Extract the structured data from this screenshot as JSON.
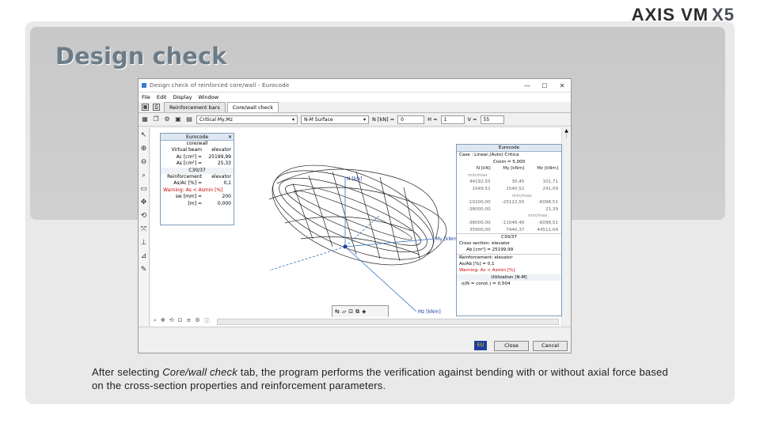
{
  "brand": {
    "logo_text": "AXIS VM",
    "logo_version": "X5"
  },
  "slide": {
    "title": "Design check",
    "caption_pre": "After selecting ",
    "caption_em": "Core/wall check",
    "caption_post": " tab, the program performs the verification against bending with or without axial force based on the cross-section properties and reinforcement parameters."
  },
  "window": {
    "title": "Design check of reinforced core/wall - Eurocode",
    "controls": {
      "minimize": "—",
      "maximize": "☐",
      "close": "✕"
    },
    "menu": [
      "File",
      "Edit",
      "Display",
      "Window"
    ],
    "tabs": [
      {
        "label": "Reinforcement bars",
        "active": false
      },
      {
        "label": "Core/wall check",
        "active": true
      }
    ],
    "toolbar": {
      "critical_dropdown": "Critical My,Mz",
      "surface_dropdown": "N-M Surface",
      "n_label": "N [kN] =",
      "n_value": "0",
      "h_label": "H =",
      "h_value": "1",
      "v_label": "V =",
      "v_value": "55"
    },
    "footer": {
      "flag_label": "EU",
      "close_button": "Close",
      "cancel_button": "Cancel"
    }
  },
  "left_panel": {
    "title": "Eurocode",
    "rows": [
      {
        "l": "core/wall",
        "v": "",
        "center": true
      },
      {
        "l": "Virtual beam",
        "v": "elevator"
      },
      {
        "l": "Ac [cm²] =",
        "v": "25199,99"
      },
      {
        "l": "As [cm²] =",
        "v": "25,33"
      },
      {
        "l": "C30/37",
        "v": "",
        "center": true
      },
      {
        "l": "Reinforcement",
        "v": "elevator"
      },
      {
        "l": "As/Ac [%] =",
        "v": "0,1"
      },
      {
        "l": "Warning: As < Asmin [%]",
        "v": "",
        "red": true
      },
      {
        "l": "sw [mm] =",
        "v": "200"
      },
      {
        "l": "[m] =",
        "v": "0,000"
      }
    ]
  },
  "right_panel": {
    "title": "Eurocode",
    "case_line": "Case : Linear,(Auto) Critica",
    "cnom_line": "Cnom = 5,000",
    "col_headers": [
      "N [kN]",
      "My [kNm]",
      "Mz [kNm]"
    ],
    "groups": [
      {
        "label": "min/max",
        "rows": [
          [
            "44192,55",
            "30,45",
            "101,71"
          ],
          [
            "1049,51",
            "1540,52",
            "241,09"
          ]
        ]
      },
      {
        "label": "min/max",
        "rows": [
          [
            "-10200,00",
            "-25122,55",
            "-6098,51"
          ],
          [
            "-38000,00",
            "",
            "21,39"
          ]
        ]
      },
      {
        "label": "min/max",
        "rows": [
          [
            "-38000,00",
            "-11046,40",
            "-6098,51"
          ],
          [
            "35900,00",
            "7440,37",
            "44511,04"
          ]
        ]
      }
    ],
    "material": "C30/37",
    "cross_section": "Cross section: elevator",
    "ab_line": "Ab [cm²] = 25199,99",
    "reinforcement": "Reinforcement: elevator",
    "as_line": "As/Ab [%] = 0,1",
    "warning": "Warning: As < Asmin [%]",
    "utilization_header": "Utilization [N-M]",
    "utilization": "η(N = const.) = 0,504"
  },
  "plot_labels": {
    "n_axis": "N [kN]",
    "my_axis": "My [kNm]",
    "mz_axis": "Mz [kNm]"
  }
}
